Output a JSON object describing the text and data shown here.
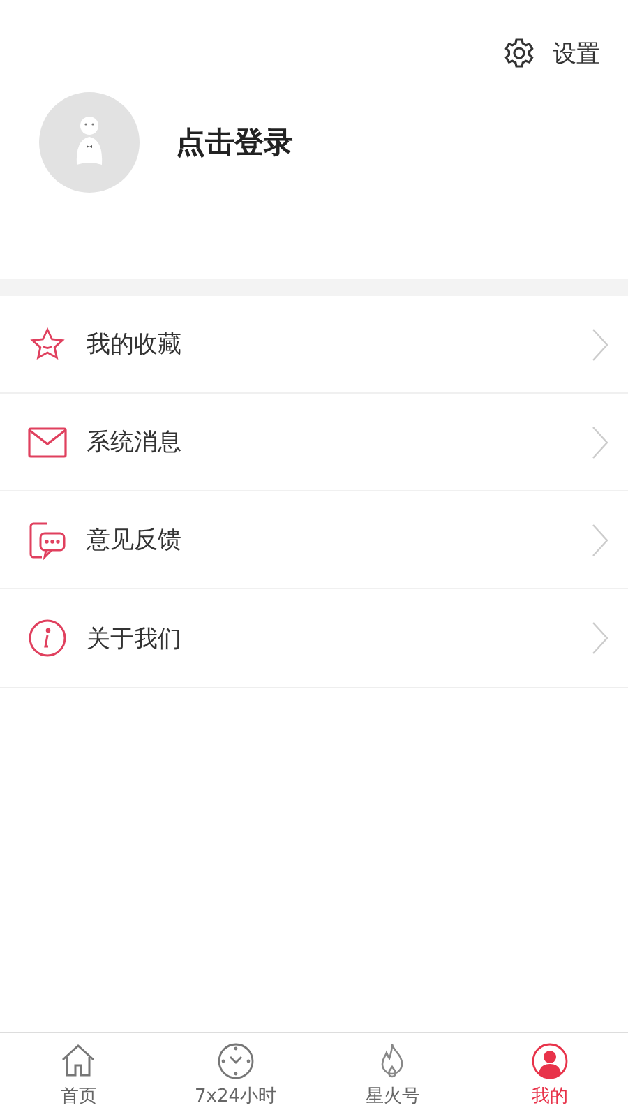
{
  "settings": {
    "label": "设置"
  },
  "profile": {
    "login": "点击登录"
  },
  "menu": [
    {
      "kind": "star",
      "label": "我的收藏"
    },
    {
      "kind": "mail",
      "label": "系统消息"
    },
    {
      "kind": "feedback",
      "label": "意见反馈"
    },
    {
      "kind": "info",
      "label": "关于我们"
    }
  ],
  "tabs": [
    {
      "kind": "home",
      "label": "首页",
      "selected": false
    },
    {
      "kind": "clock",
      "label": "7x24小时",
      "selected": false
    },
    {
      "kind": "flame",
      "label": "星火号",
      "selected": false
    },
    {
      "kind": "person",
      "label": "我的",
      "selected": true
    }
  ]
}
